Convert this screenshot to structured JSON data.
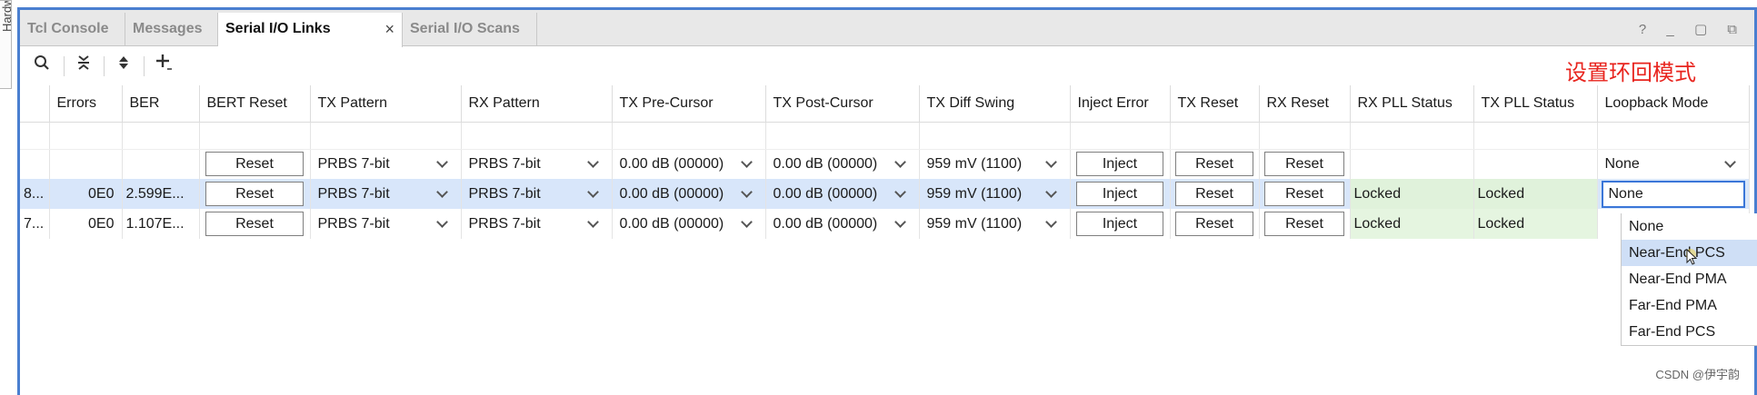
{
  "side_tab": {
    "label": "Hardware"
  },
  "tabs": [
    {
      "label": "Tcl Console",
      "active": false
    },
    {
      "label": "Messages",
      "active": false
    },
    {
      "label": "Serial I/O Links",
      "active": true
    },
    {
      "label": "Serial I/O Scans",
      "active": false
    }
  ],
  "tab_close": "×",
  "window_controls": "? _ ▢ ⧉",
  "annotation": "设置环回模式",
  "table": {
    "columns": [
      "",
      "Errors",
      "BER",
      "BERT Reset",
      "TX Pattern",
      "RX Pattern",
      "TX Pre-Cursor",
      "TX Post-Cursor",
      "TX Diff Swing",
      "Inject Error",
      "TX Reset",
      "RX Reset",
      "RX PLL Status",
      "TX PLL Status",
      "Loopback Mode"
    ],
    "group_row": {
      "bert_reset": "Reset",
      "tx_pattern": "PRBS 7-bit",
      "rx_pattern": "PRBS 7-bit",
      "tx_pre": "0.00 dB (00000)",
      "tx_post": "0.00 dB (00000)",
      "tx_swing": "959 mV (1100)",
      "inject": "Inject",
      "tx_reset": "Reset",
      "rx_reset": "Reset",
      "loopback": "None"
    },
    "rows": [
      {
        "name": "8...",
        "errors": "0E0",
        "ber": "2.599E...",
        "bert_reset": "Reset",
        "tx_pattern": "PRBS 7-bit",
        "rx_pattern": "PRBS 7-bit",
        "tx_pre": "0.00 dB (00000)",
        "tx_post": "0.00 dB (00000)",
        "tx_swing": "959 mV (1100)",
        "inject": "Inject",
        "tx_reset": "Reset",
        "rx_reset": "Reset",
        "rx_pll": "Locked",
        "tx_pll": "Locked",
        "loopback": "None"
      },
      {
        "name": "7...",
        "errors": "0E0",
        "ber": "1.107E...",
        "bert_reset": "Reset",
        "tx_pattern": "PRBS 7-bit",
        "rx_pattern": "PRBS 7-bit",
        "tx_pre": "0.00 dB (00000)",
        "tx_post": "0.00 dB (00000)",
        "tx_swing": "959 mV (1100)",
        "inject": "Inject",
        "tx_reset": "Reset",
        "rx_reset": "Reset",
        "rx_pll": "Locked",
        "tx_pll": "Locked"
      }
    ]
  },
  "loopback_options": [
    "None",
    "Near-End PCS",
    "Near-End PMA",
    "Far-End PMA",
    "Far-End PCS"
  ],
  "loopback_highlighted": "Near-End PCS",
  "watermark": "CSDN @伊宇韵",
  "colors": {
    "accent": "#4a7fd0",
    "selected_row": "#d8e6fa",
    "locked_bg": "#e5f5e0",
    "annotation": "#e8241e"
  }
}
